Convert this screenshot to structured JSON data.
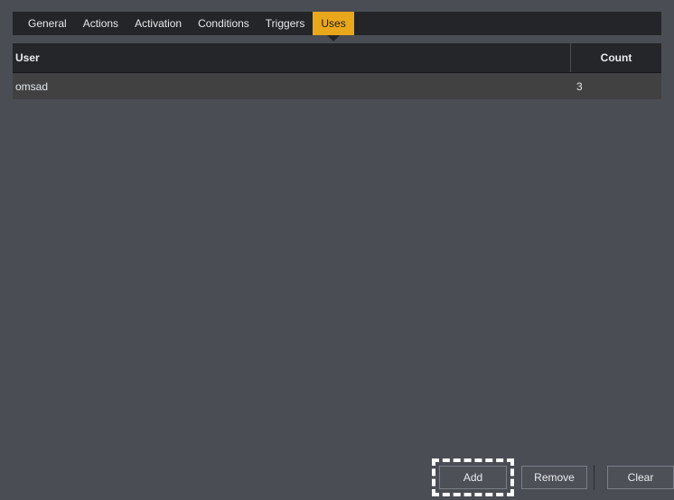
{
  "window": {
    "background_color": "#4a4d54"
  },
  "tabs": {
    "accent_color": "#e9a71b",
    "bar_color": "#242528",
    "items": [
      {
        "label": "General",
        "active": false
      },
      {
        "label": "Actions",
        "active": false
      },
      {
        "label": "Activation",
        "active": false
      },
      {
        "label": "Conditions",
        "active": false
      },
      {
        "label": "Triggers",
        "active": false
      },
      {
        "label": "Uses",
        "active": true
      }
    ]
  },
  "table": {
    "columns": [
      {
        "label": "User"
      },
      {
        "label": "Count"
      }
    ],
    "rows": [
      {
        "user": "omsad",
        "count": "3"
      }
    ]
  },
  "buttons": {
    "add_label": "Add",
    "remove_label": "Remove",
    "clear_label": "Clear",
    "focused": "Add"
  }
}
